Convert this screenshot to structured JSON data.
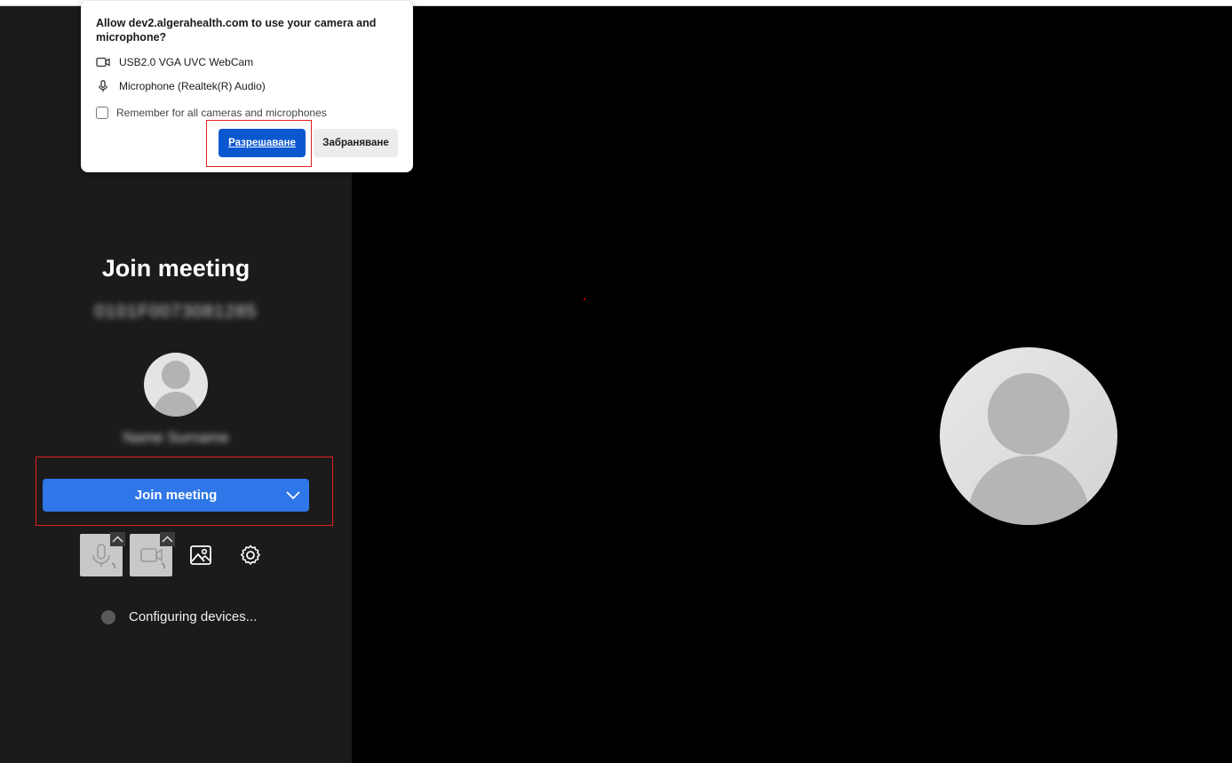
{
  "permission_prompt": {
    "title": "Allow dev2.algerahealth.com to use your camera and microphone?",
    "camera_label": "USB2.0 VGA UVC WebCam",
    "microphone_label": "Microphone (Realtek(R) Audio)",
    "remember_label": "Remember for all cameras and microphones",
    "remember_checked": false,
    "allow_label": "Разрешаване",
    "deny_label": "Забраняване"
  },
  "prejoin": {
    "title": "Join meeting",
    "meeting_id": "0101F0073081285",
    "user_name": "Name Surname",
    "join_label": "Join meeting",
    "status_text": "Configuring devices..."
  },
  "icons": {
    "camera": "webcam-icon",
    "microphone": "microphone-icon",
    "background": "background-image-icon",
    "settings": "gear-icon",
    "chevron": "chevron-down-icon",
    "caret": "chevron-up-icon"
  },
  "colors": {
    "join_button": "#2f76e8",
    "allow_button": "#0b57d0",
    "highlight": "#e02020",
    "sidebar_bg": "#1b1b1b"
  }
}
